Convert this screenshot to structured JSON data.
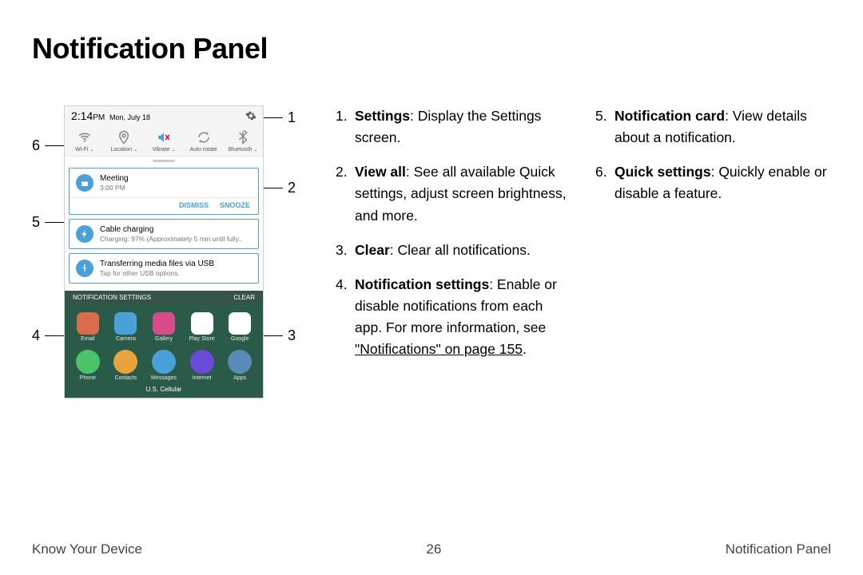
{
  "title": "Notification Panel",
  "phone": {
    "time": "2:14",
    "ampm": "PM",
    "date": "Mon, July 18",
    "quick_settings": [
      {
        "label": "Wi-Fi",
        "arrow": true
      },
      {
        "label": "Location",
        "arrow": true
      },
      {
        "label": "Vibrate",
        "arrow": true
      },
      {
        "label": "Auto rotate",
        "arrow": false
      },
      {
        "label": "Bluetooth",
        "arrow": true
      }
    ],
    "notifications": [
      {
        "title": "Meeting",
        "sub": "3:00 PM",
        "actions": [
          "DISMISS",
          "SNOOZE"
        ]
      },
      {
        "title": "Cable charging",
        "sub": "Charging: 97% (Approximately 5 min until fully..",
        "actions": []
      },
      {
        "title": "Transferring media files via USB",
        "sub": "Tap for other USB options.",
        "actions": []
      }
    ],
    "panel_footer_left": "NOTIFICATION SETTINGS",
    "panel_footer_right": "CLEAR",
    "home_apps": [
      "Email",
      "Camera",
      "Gallery",
      "Play Store",
      "Google"
    ],
    "dock_apps": [
      "Phone",
      "Contacts",
      "Messages",
      "Internet",
      "Apps"
    ],
    "carrier": "U.S. Cellular"
  },
  "callouts": {
    "c1": "1",
    "c2": "2",
    "c3": "3",
    "c4": "4",
    "c5": "5",
    "c6": "6"
  },
  "desc": {
    "left": [
      {
        "n": "1.",
        "bold": "Settings",
        "text": ": Display the Settings screen."
      },
      {
        "n": "2.",
        "bold": "View all",
        "text": ": See all available Quick settings, adjust screen brightness, and more."
      },
      {
        "n": "3.",
        "bold": "Clear",
        "text": ": Clear all notifications."
      },
      {
        "n": "4.",
        "bold": "Notification settings",
        "text": ": Enable or disable notifications from each app. For more information, see ",
        "link": "\"Notifications\" on page 155",
        "suffix": "."
      }
    ],
    "right": [
      {
        "n": "5.",
        "bold": "Notification card",
        "text": ": View details about a notification."
      },
      {
        "n": "6.",
        "bold": "Quick settings",
        "text": ": Quickly enable or disable a feature."
      }
    ]
  },
  "footer": {
    "left": "Know Your Device",
    "center": "26",
    "right": "Notification Panel"
  }
}
